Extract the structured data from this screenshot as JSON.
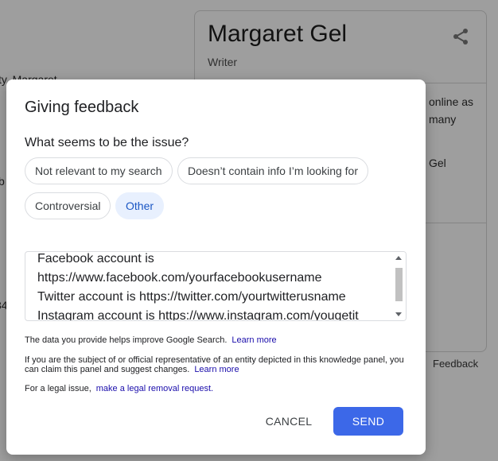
{
  "background": {
    "left_fragments": [
      "ty. Margaret",
      "b",
      "34"
    ],
    "panel": {
      "title": "Margaret Gel",
      "subtitle": "Writer",
      "text_fragments": [
        "online as",
        "many",
        "Gel"
      ],
      "feedback_label": "Feedback",
      "share_icon": "share-icon"
    }
  },
  "dialog": {
    "title": "Giving feedback",
    "question": "What seems to be the issue?",
    "chips": [
      {
        "label": "Not relevant to my search",
        "selected": false
      },
      {
        "label": "Doesn’t contain info I’m looking for",
        "selected": false
      },
      {
        "label": "Controversial",
        "selected": false
      },
      {
        "label": "Other",
        "selected": true
      }
    ],
    "textbox_lines": [
      "Facebook account is",
      "https://www.facebook.com/yourfacebookusername",
      "Twitter account is https://twitter.com/yourtwitterusname",
      "Instagram account is https://www.instagram.com/yougetit"
    ],
    "info_text": "The data you provide helps improve Google Search.",
    "info_link": "Learn more",
    "claim_text": "If you are the subject of or official representative of an entity depicted in this knowledge panel, you can claim this panel and suggest changes.",
    "claim_link": "Learn more",
    "legal_text": "For a legal issue,",
    "legal_link": "make a legal removal request.",
    "cancel_label": "CANCEL",
    "send_label": "SEND"
  },
  "colors": {
    "accent": "#3c68e8",
    "selected_chip_bg": "#e8f0fe",
    "link": "#1a0dab",
    "scrim": "#9e9e9e"
  }
}
